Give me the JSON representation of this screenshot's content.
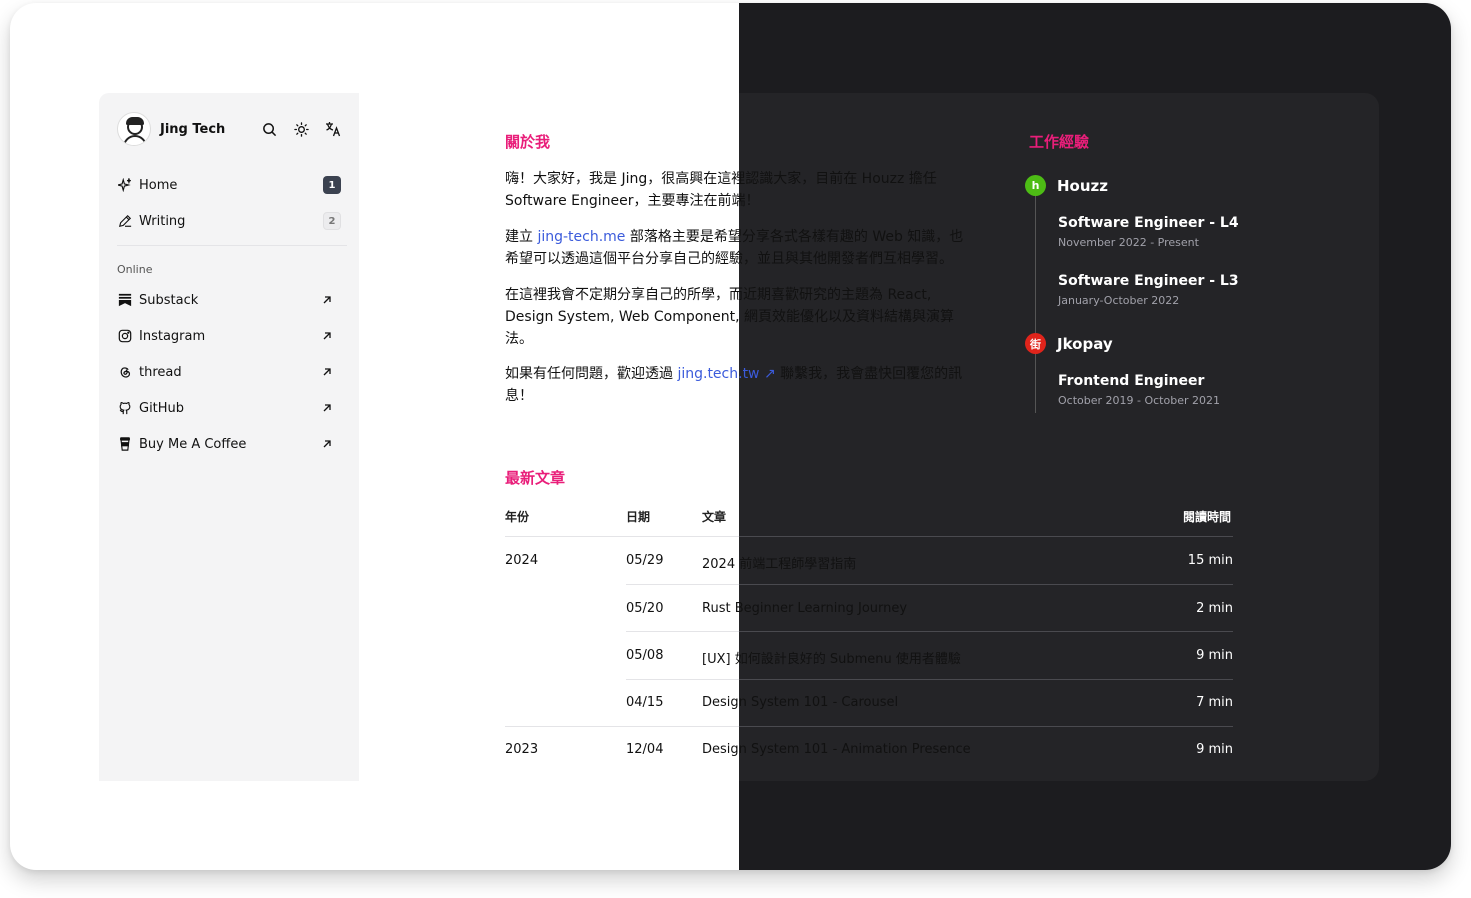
{
  "sidebar": {
    "site_name": "Jing Tech",
    "header_icons": [
      "search-icon",
      "sun-icon",
      "translate-icon"
    ],
    "nav": [
      {
        "label": "Home",
        "icon": "sparkle-icon",
        "badge": "1"
      },
      {
        "label": "Writing",
        "icon": "pen-icon",
        "badge": "2"
      }
    ],
    "online_label": "Online",
    "online": [
      {
        "label": "Substack",
        "icon": "substack-icon"
      },
      {
        "label": "Instagram",
        "icon": "instagram-icon"
      },
      {
        "label": "thread",
        "icon": "threads-icon"
      },
      {
        "label": "GitHub",
        "icon": "github-icon"
      },
      {
        "label": "Buy Me A Coffee",
        "icon": "coffee-icon"
      }
    ]
  },
  "about": {
    "heading": "關於我",
    "p1": "嗨！大家好，我是 Jing，很高興在這裡認識大家，目前在 Houzz 擔任 Software Engineer，主要專注在前端！",
    "p2_before": "建立 ",
    "p2_link": "jing-tech.me",
    "p2_after": " 部落格主要是希望分享各式各樣有趣的 Web 知識，也希望可以透過這個平台分享自己的經驗，並且與其他開發者們互相學習。",
    "p3": "在這裡我會不定期分享自己的所學，而近期喜歡研究的主題為 React, Design System, Web Component, 網頁效能優化以及資料結構與演算法。",
    "p4_before": "如果有任何問題，歡迎透過 ",
    "p4_link": "jing.tech.tw ↗",
    "p4_after": " 聯繫我，我會盡快回覆您的訊息！"
  },
  "experience": {
    "heading": "工作經驗",
    "companies": [
      {
        "name": "Houzz",
        "logo": "h",
        "logo_color": "#4dbc15",
        "roles": [
          {
            "title": "Software Engineer - L4",
            "period": "November 2022 - Present"
          },
          {
            "title": "Software Engineer - L3",
            "period": "January-October 2022"
          }
        ]
      },
      {
        "name": "Jkopay",
        "logo": "街",
        "logo_color": "#e0241b",
        "roles": [
          {
            "title": "Frontend Engineer",
            "period": "October 2019 - October 2021"
          }
        ]
      }
    ]
  },
  "articles": {
    "heading": "最新文章",
    "columns": [
      "年份",
      "日期",
      "文章",
      "閱讀時間"
    ],
    "rows": [
      {
        "year": "2024",
        "date": "05/29",
        "title": "2024 前端工程師學習指南",
        "time": "15 min"
      },
      {
        "year": "",
        "date": "05/20",
        "title": "Rust Beginner Learning Journey",
        "time": "2 min"
      },
      {
        "year": "",
        "date": "05/08",
        "title": "[UX] 如何設計良好的 Submenu 使用者體驗",
        "time": "9 min"
      },
      {
        "year": "",
        "date": "04/15",
        "title": "Design System 101 - Carousel",
        "time": "7 min"
      },
      {
        "year": "2023",
        "date": "12/04",
        "title": "Design System 101 - Animation Presence",
        "time": "9 min"
      }
    ]
  },
  "colors": {
    "accent": "#e91e7a",
    "link": "#3b5bdb",
    "dark_bg": "#1c1c1f"
  }
}
